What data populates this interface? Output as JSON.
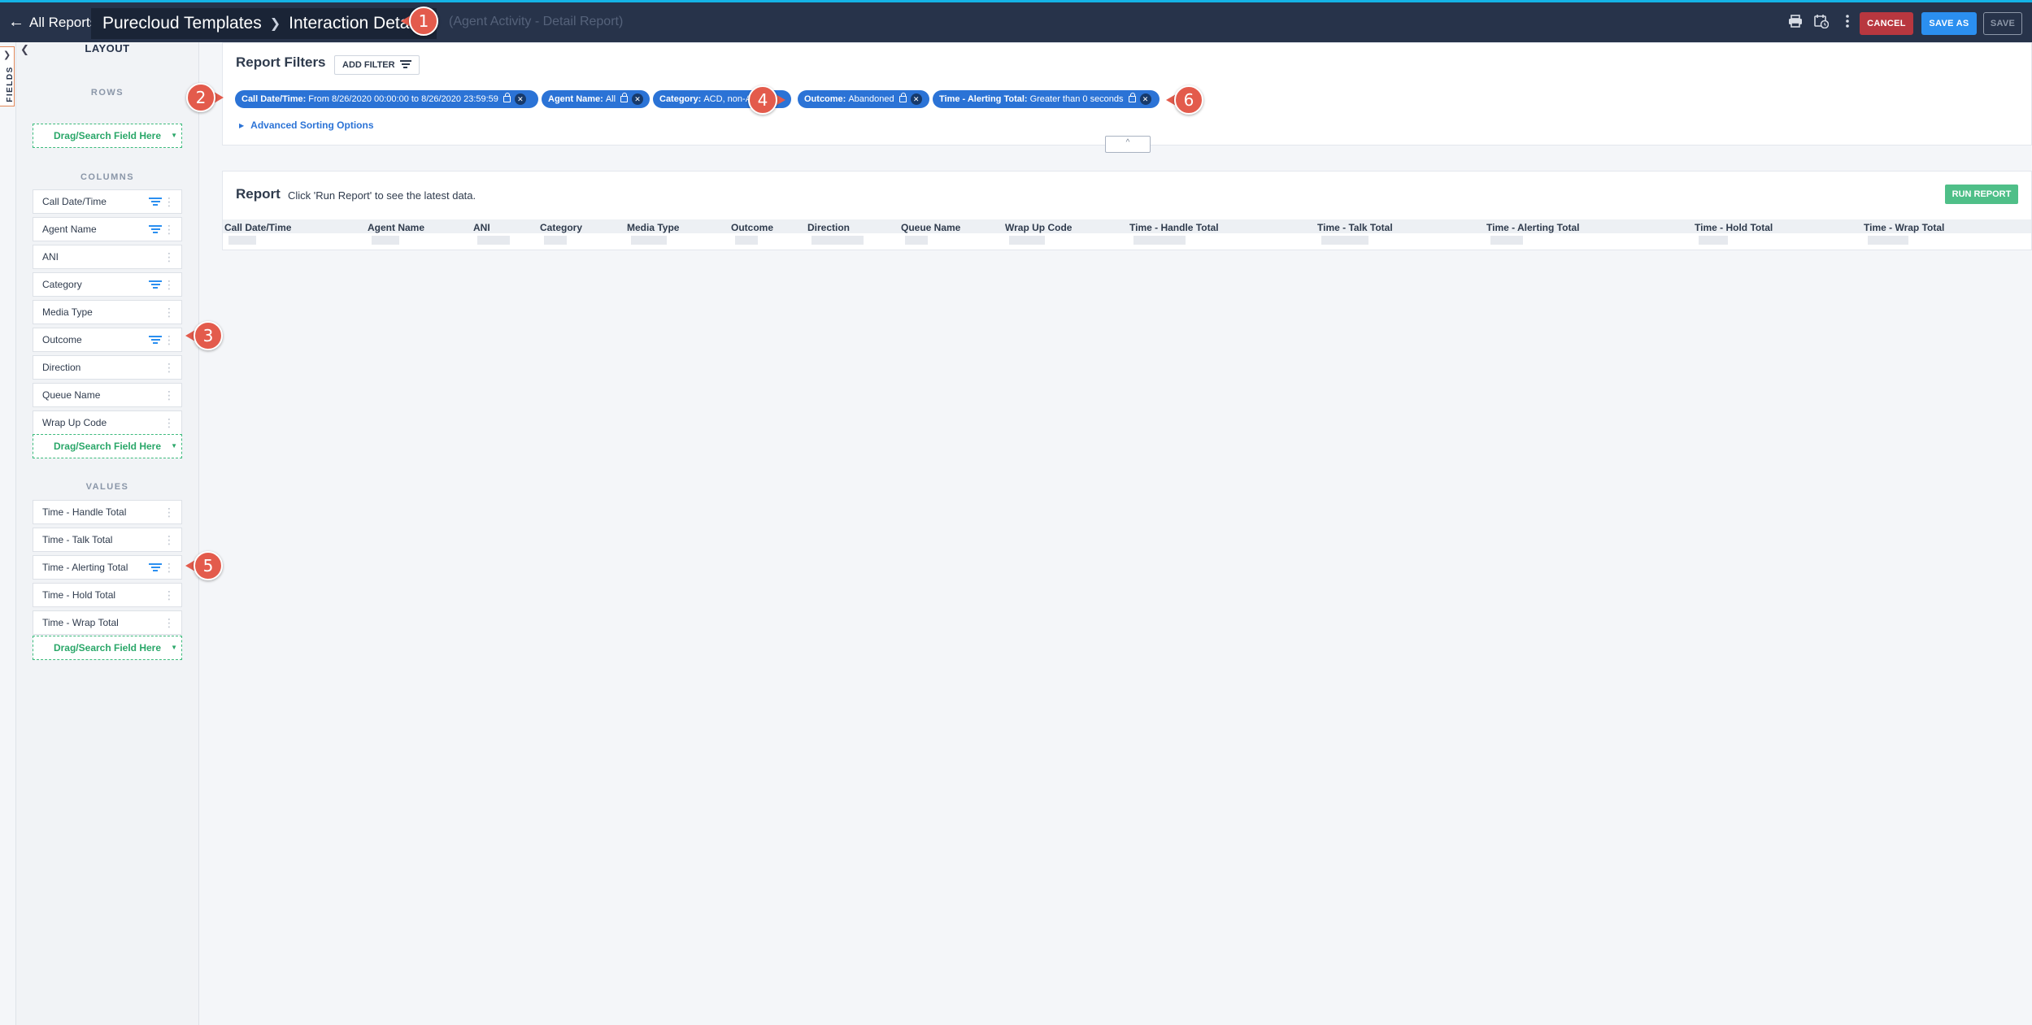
{
  "topbar": {
    "back_label": "All Reports",
    "breadcrumb": [
      "Purecloud Templates",
      "Interaction Details"
    ],
    "subtitle": "(Agent Activity - Detail Report)",
    "icons": [
      "print-icon",
      "schedule-icon",
      "more-vert-icon"
    ],
    "cancel_label": "CANCEL",
    "save_as_label": "SAVE AS",
    "save_label": "SAVE"
  },
  "fields_tab": {
    "label": "FIELDS"
  },
  "layout": {
    "title": "LAYOUT",
    "rows_label": "ROWS",
    "columns_label": "COLUMNS",
    "values_label": "VALUES",
    "drop_label": "Drag/Search Field Here",
    "columns": [
      {
        "name": "Call Date/Time",
        "filtered": true
      },
      {
        "name": "Agent Name",
        "filtered": true
      },
      {
        "name": "ANI",
        "filtered": false
      },
      {
        "name": "Category",
        "filtered": true
      },
      {
        "name": "Media Type",
        "filtered": false
      },
      {
        "name": "Outcome",
        "filtered": true
      },
      {
        "name": "Direction",
        "filtered": false
      },
      {
        "name": "Queue Name",
        "filtered": false
      },
      {
        "name": "Wrap Up Code",
        "filtered": false
      }
    ],
    "values": [
      {
        "name": "Time - Handle Total",
        "filtered": false
      },
      {
        "name": "Time - Talk Total",
        "filtered": false
      },
      {
        "name": "Time - Alerting Total",
        "filtered": true
      },
      {
        "name": "Time - Hold Total",
        "filtered": false
      },
      {
        "name": "Time - Wrap Total",
        "filtered": false
      }
    ]
  },
  "filters": {
    "title": "Report Filters",
    "add_filter_label": "ADD FILTER",
    "chips": [
      {
        "field": "Call Date/Time:",
        "value": "From 8/26/2020 00:00:00 to 8/26/2020 23:59:59"
      },
      {
        "field": "Agent Name:",
        "value": "All"
      },
      {
        "field": "Category:",
        "value": "ACD, non-ACD"
      },
      {
        "field": "Outcome:",
        "value": "Abandoned"
      },
      {
        "field": "Time - Alerting Total:",
        "value": "Greater than 0 seconds"
      }
    ],
    "advanced_label": "Advanced Sorting Options",
    "collapse_glyph": "^"
  },
  "report": {
    "title": "Report",
    "hint": "Click 'Run Report' to see the latest data.",
    "run_label": "RUN REPORT",
    "columns": [
      "Call Date/Time",
      "Agent Name",
      "ANI",
      "Category",
      "Media Type",
      "Outcome",
      "Direction",
      "Queue Name",
      "Wrap Up Code",
      "Time - Handle Total",
      "Time - Talk Total",
      "Time - Alerting Total",
      "Time - Hold Total",
      "Time - Wrap Total"
    ]
  },
  "callouts": [
    "1",
    "2",
    "3",
    "4",
    "5",
    "6"
  ],
  "colors": {
    "topbar": "#27334a",
    "accent_blue": "#2b73d6",
    "cancel": "#b8373f",
    "save_as": "#2b8ff0",
    "run": "#4fbf88",
    "callout": "#e35b4c",
    "drop_green": "#2aa769"
  }
}
